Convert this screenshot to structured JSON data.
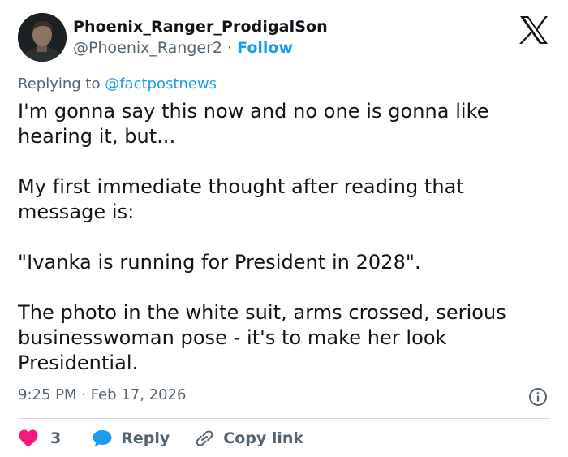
{
  "author": {
    "display_name": "Phoenix_Ranger_ProdigalSon",
    "handle": "@Phoenix_Ranger2",
    "separator": " · ",
    "follow_label": "Follow"
  },
  "reply_context": {
    "prefix": "Replying to ",
    "mention": "@factpostnews"
  },
  "tweet": {
    "paragraphs": [
      "I'm gonna say this now and no one is gonna like hearing it, but...",
      "My first immediate thought after reading that message is:",
      "\"Ivanka is running for President in 2028\".",
      "The photo in the white suit, arms crossed, serious businesswoman pose - it's to make her look Presidential."
    ],
    "timestamp": "9:25 PM · Feb 17, 2026"
  },
  "actions": {
    "like_count": "3",
    "reply_label": "Reply",
    "copy_label": "Copy link"
  },
  "icons": {
    "logo": "x-logo-icon",
    "info": "info-icon",
    "like": "heart-icon",
    "reply": "speech-bubble-icon",
    "copy": "link-icon"
  },
  "colors": {
    "text": "#0f1419",
    "secondary": "#536471",
    "accent": "#1d9bf0",
    "like": "#f91880",
    "divider": "#cfd9de"
  }
}
